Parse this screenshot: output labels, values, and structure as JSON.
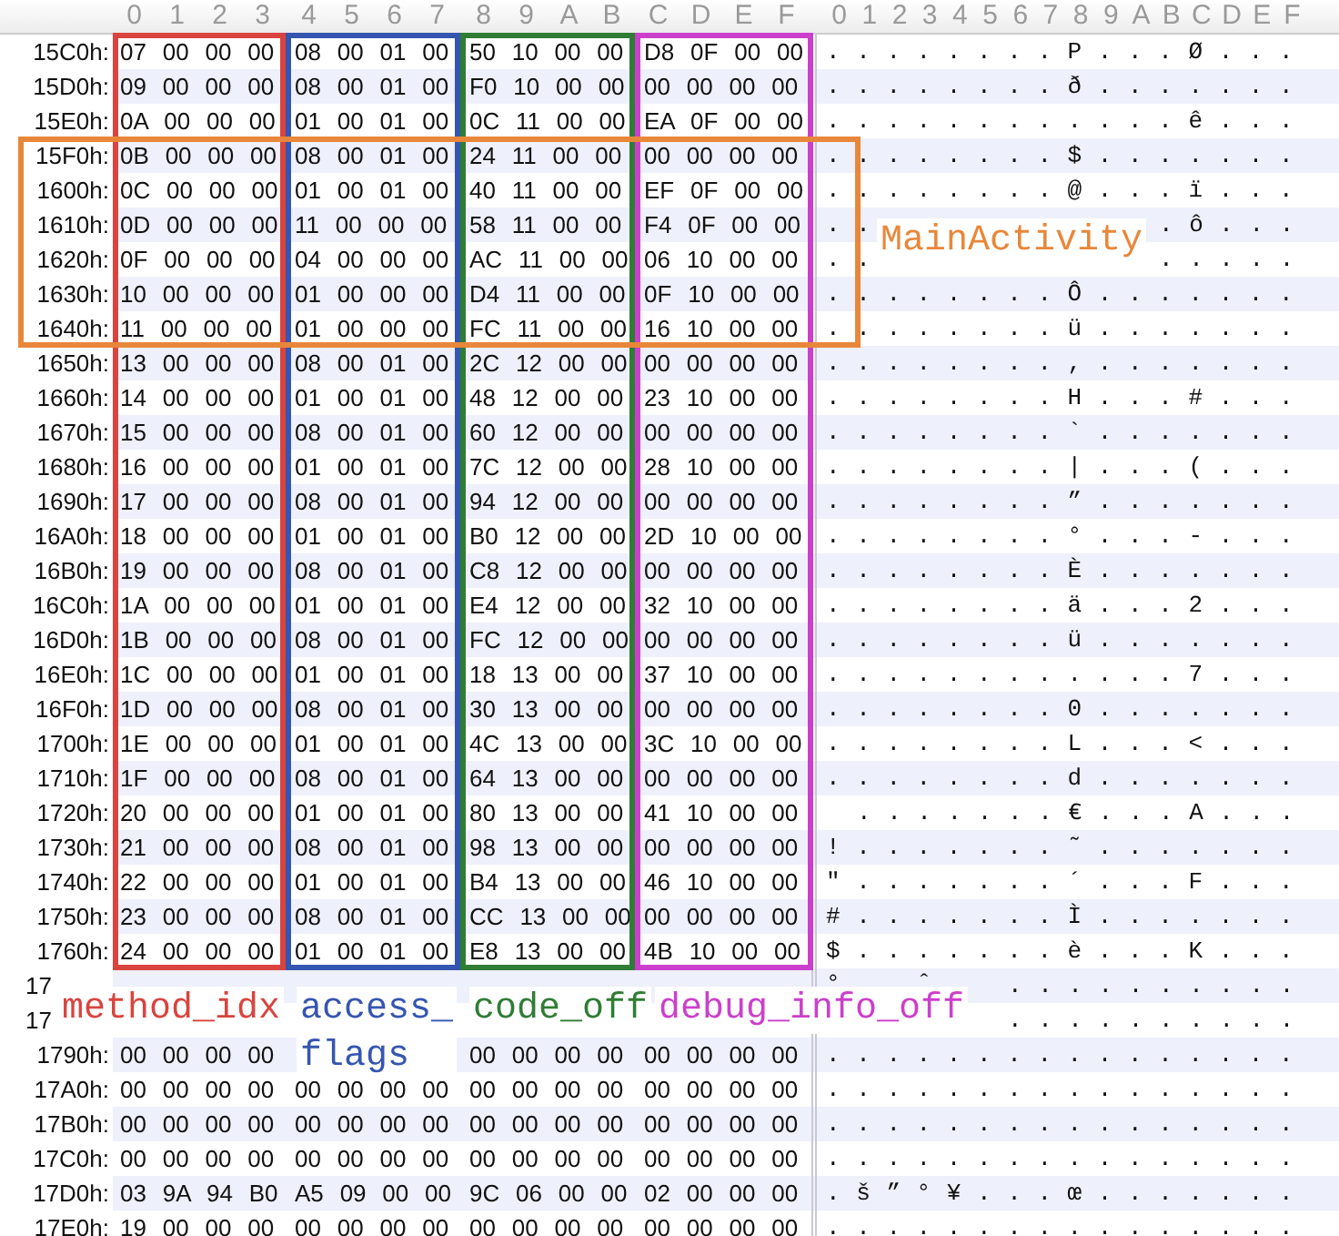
{
  "column_headers": {
    "hex": [
      "0",
      "1",
      "2",
      "3",
      "4",
      "5",
      "6",
      "7",
      "8",
      "9",
      "A",
      "B",
      "C",
      "D",
      "E",
      "F"
    ],
    "ascii": [
      "0",
      "1",
      "2",
      "3",
      "4",
      "5",
      "6",
      "7",
      "8",
      "9",
      "A",
      "B",
      "C",
      "D",
      "E",
      "F"
    ]
  },
  "rows": [
    {
      "address": "15C0h:",
      "kind": "encoded_method",
      "main_activity": false,
      "hex": [
        "07 00 00 00",
        "08 00 01 00",
        "50 10 00 00",
        "D8 0F 00 00"
      ],
      "ascii": [
        "........P...Ø..."
      ]
    },
    {
      "address": "15D0h:",
      "kind": "encoded_method",
      "main_activity": false,
      "hex": [
        "09 00 00 00",
        "08 00 01 00",
        "F0 10 00 00",
        "00 00 00 00"
      ],
      "ascii": [
        "........ð......."
      ]
    },
    {
      "address": "15E0h:",
      "kind": "encoded_method",
      "main_activity": false,
      "hex": [
        "0A 00 00 00",
        "01 00 01 00",
        "0C 11 00 00",
        "EA 0F 00 00"
      ],
      "ascii": [
        "............ê..."
      ]
    },
    {
      "address": "15F0h:",
      "kind": "encoded_method",
      "main_activity": true,
      "hex": [
        "0B 00 00 00",
        "08 00 01 00",
        "24 11 00 00",
        "00 00 00 00"
      ],
      "ascii": [
        "........$......."
      ]
    },
    {
      "address": "1600h:",
      "kind": "encoded_method",
      "main_activity": true,
      "hex": [
        "0C 00 00 00",
        "01 00 01 00",
        "40 11 00 00",
        "EF 0F 00 00"
      ],
      "ascii": [
        "........@...ï..."
      ]
    },
    {
      "address": "1610h:",
      "kind": "encoded_method",
      "main_activity": true,
      "hex": [
        "0D 00 00 00",
        "11 00 00 00",
        "58 11 00 00",
        "F4 0F 00 00"
      ],
      "ascii": [
        "..",
        ".ô..."
      ]
    },
    {
      "address": "1620h:",
      "kind": "encoded_method",
      "main_activity": true,
      "hex": [
        "0F 00 00 00",
        "04 00 00 00",
        "AC 11 00 00",
        "06 10 00 00"
      ],
      "ascii": [
        "..",
        "....."
      ]
    },
    {
      "address": "1630h:",
      "kind": "encoded_method",
      "main_activity": true,
      "hex": [
        "10 00 00 00",
        "01 00 00 00",
        "D4 11 00 00",
        "0F 10 00 00"
      ],
      "ascii": [
        "........Ô......."
      ]
    },
    {
      "address": "1640h:",
      "kind": "encoded_method",
      "main_activity": true,
      "hex": [
        "11 00 00 00",
        "01 00 00 00",
        "FC 11 00 00",
        "16 10 00 00"
      ],
      "ascii": [
        "........ü......."
      ]
    },
    {
      "address": "1650h:",
      "kind": "encoded_method",
      "main_activity": false,
      "hex": [
        "13 00 00 00",
        "08 00 01 00",
        "2C 12 00 00",
        "00 00 00 00"
      ],
      "ascii": [
        "........,......."
      ]
    },
    {
      "address": "1660h:",
      "kind": "encoded_method",
      "main_activity": false,
      "hex": [
        "14 00 00 00",
        "01 00 01 00",
        "48 12 00 00",
        "23 10 00 00"
      ],
      "ascii": [
        "........H...#..."
      ]
    },
    {
      "address": "1670h:",
      "kind": "encoded_method",
      "main_activity": false,
      "hex": [
        "15 00 00 00",
        "08 00 01 00",
        "60 12 00 00",
        "00 00 00 00"
      ],
      "ascii": [
        "........`......."
      ]
    },
    {
      "address": "1680h:",
      "kind": "encoded_method",
      "main_activity": false,
      "hex": [
        "16 00 00 00",
        "01 00 01 00",
        "7C 12 00 00",
        "28 10 00 00"
      ],
      "ascii": [
        "........|...(..."
      ]
    },
    {
      "address": "1690h:",
      "kind": "encoded_method",
      "main_activity": false,
      "hex": [
        "17 00 00 00",
        "08 00 01 00",
        "94 12 00 00",
        "00 00 00 00"
      ],
      "ascii": [
        "........”......."
      ]
    },
    {
      "address": "16A0h:",
      "kind": "encoded_method",
      "main_activity": false,
      "hex": [
        "18 00 00 00",
        "01 00 01 00",
        "B0 12 00 00",
        "2D 10 00 00"
      ],
      "ascii": [
        "........°...-..."
      ]
    },
    {
      "address": "16B0h:",
      "kind": "encoded_method",
      "main_activity": false,
      "hex": [
        "19 00 00 00",
        "08 00 01 00",
        "C8 12 00 00",
        "00 00 00 00"
      ],
      "ascii": [
        "........È......."
      ]
    },
    {
      "address": "16C0h:",
      "kind": "encoded_method",
      "main_activity": false,
      "hex": [
        "1A 00 00 00",
        "01 00 01 00",
        "E4 12 00 00",
        "32 10 00 00"
      ],
      "ascii": [
        "........ä...2..."
      ]
    },
    {
      "address": "16D0h:",
      "kind": "encoded_method",
      "main_activity": false,
      "hex": [
        "1B 00 00 00",
        "08 00 01 00",
        "FC 12 00 00",
        "00 00 00 00"
      ],
      "ascii": [
        "........ü......."
      ]
    },
    {
      "address": "16E0h:",
      "kind": "encoded_method",
      "main_activity": false,
      "hex": [
        "1C 00 00 00",
        "01 00 01 00",
        "18 13 00 00",
        "37 10 00 00"
      ],
      "ascii": [
        "............7..."
      ]
    },
    {
      "address": "16F0h:",
      "kind": "encoded_method",
      "main_activity": false,
      "hex": [
        "1D 00 00 00",
        "08 00 01 00",
        "30 13 00 00",
        "00 00 00 00"
      ],
      "ascii": [
        "........0......."
      ]
    },
    {
      "address": "1700h:",
      "kind": "encoded_method",
      "main_activity": false,
      "hex": [
        "1E 00 00 00",
        "01 00 01 00",
        "4C 13 00 00",
        "3C 10 00 00"
      ],
      "ascii": [
        "........L...<..."
      ]
    },
    {
      "address": "1710h:",
      "kind": "encoded_method",
      "main_activity": false,
      "hex": [
        "1F 00 00 00",
        "08 00 01 00",
        "64 13 00 00",
        "00 00 00 00"
      ],
      "ascii": [
        "........d......."
      ]
    },
    {
      "address": "1720h:",
      "kind": "encoded_method",
      "main_activity": false,
      "hex": [
        "20 00 00 00",
        "01 00 01 00",
        "80 13 00 00",
        "41 10 00 00"
      ],
      "ascii": [
        ".......€...A..."
      ]
    },
    {
      "address": "1730h:",
      "kind": "encoded_method",
      "main_activity": false,
      "hex": [
        "21 00 00 00",
        "08 00 01 00",
        "98 13 00 00",
        "00 00 00 00"
      ],
      "ascii": [
        "!.......˜......."
      ]
    },
    {
      "address": "1740h:",
      "kind": "encoded_method",
      "main_activity": false,
      "hex": [
        "22 00 00 00",
        "01 00 01 00",
        "B4 13 00 00",
        "46 10 00 00"
      ],
      "ascii": [
        "\".......´...F..."
      ]
    },
    {
      "address": "1750h:",
      "kind": "encoded_method",
      "main_activity": false,
      "hex": [
        "23 00 00 00",
        "08 00 01 00",
        "CC 13 00 00",
        "00 00 00 00"
      ],
      "ascii": [
        "#.......Ì......."
      ]
    },
    {
      "address": "1760h:",
      "kind": "encoded_method",
      "main_activity": false,
      "hex": [
        "24 00 00 00",
        "01 00 01 00",
        "E8 13 00 00",
        "4B 10 00 00"
      ],
      "ascii": [
        "$.......è...K..."
      ]
    },
    {
      "address": "17",
      "kind": "covered",
      "main_activity": false,
      "ascii": [
        "°",
        "ˆ",
        ".........."
      ]
    },
    {
      "address": "17",
      "kind": "covered",
      "main_activity": false,
      "ascii": [
        ".........."
      ]
    },
    {
      "address": "1790h:",
      "kind": "partly_covered",
      "main_activity": false,
      "hex": [
        "00 00 00 00",
        "00 00 00 00",
        "00 00 00 00"
      ],
      "ascii": [
        "................"
      ]
    },
    {
      "address": "17A0h:",
      "kind": "data",
      "main_activity": false,
      "hex": [
        "00 00 00 00",
        "00 00 00 00",
        "00 00 00 00",
        "00 00 00 00"
      ],
      "ascii": [
        "................"
      ]
    },
    {
      "address": "17B0h:",
      "kind": "data",
      "main_activity": false,
      "hex": [
        "00 00 00 00",
        "00 00 00 00",
        "00 00 00 00",
        "00 00 00 00"
      ],
      "ascii": [
        "................"
      ]
    },
    {
      "address": "17C0h:",
      "kind": "data",
      "main_activity": false,
      "hex": [
        "00 00 00 00",
        "00 00 00 00",
        "00 00 00 00",
        "00 00 00 00"
      ],
      "ascii": [
        "................"
      ]
    },
    {
      "address": "17D0h:",
      "kind": "data",
      "main_activity": false,
      "hex": [
        "03 9A 94 B0",
        "A5 09 00 00",
        "9C 06 00 00",
        "02 00 00 00"
      ],
      "ascii": [
        ".š”°¥...œ......."
      ]
    },
    {
      "address": "17E0h:",
      "kind": "data",
      "main_activity": false,
      "hex": [
        "19 00 00 00",
        "00 00 00 00",
        "00 00 00 00",
        "00 00 00 00"
      ],
      "ascii": [
        "................"
      ]
    }
  ],
  "field_boxes": [
    {
      "lines": [
        "method_idx"
      ],
      "color": "#d9443f"
    },
    {
      "lines": [
        "access_",
        "flags"
      ],
      "color": "#3556b0"
    },
    {
      "lines": [
        "code_off"
      ],
      "color": "#2f7d35"
    },
    {
      "lines": [
        "debug_info_off"
      ],
      "color": "#cc3fcc"
    }
  ],
  "main_activity_box": {
    "label": "MainActivity",
    "color": "#e8873a"
  }
}
